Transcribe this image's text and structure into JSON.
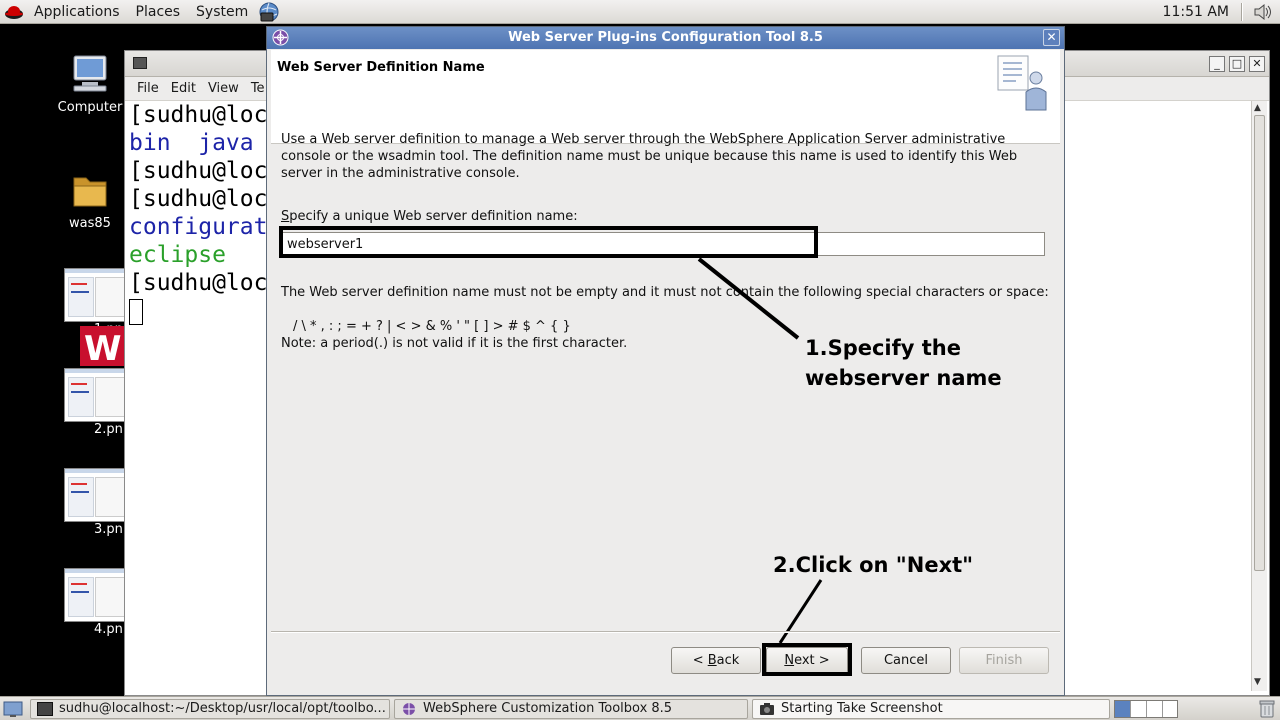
{
  "top_panel": {
    "menus": [
      "Applications",
      "Places",
      "System"
    ],
    "clock": "11:51 AM"
  },
  "desktop": {
    "icons": [
      {
        "label": "Computer"
      },
      {
        "label": "was85"
      }
    ],
    "thumbnails": [
      {
        "label": "1.pn"
      },
      {
        "label": "2.pn"
      },
      {
        "label": "3.pn"
      },
      {
        "label": "4.pn"
      }
    ]
  },
  "terminal": {
    "menus": [
      "File",
      "Edit",
      "View",
      "Te"
    ],
    "lines": [
      {
        "text": "[sudhu@loc",
        "color": "default"
      },
      {
        "text": "bin  java ",
        "color": "blue"
      },
      {
        "text": "[sudhu@loc",
        "color": "default"
      },
      {
        "text": "[sudhu@loc",
        "color": "default"
      },
      {
        "text": "configurat",
        "color": "blue"
      },
      {
        "text": "eclipse",
        "color": "green"
      },
      {
        "text": "[sudhu@loc",
        "color": "default"
      }
    ]
  },
  "dialog": {
    "title": "Web Server Plug-ins Configuration Tool 8.5",
    "header_title": "Web Server Definition Name",
    "description": "Use a Web server definition to manage a Web server through the WebSphere Application Server administrative console or the wsadmin tool. The definition name must be unique because this name is used to identify this Web server in the administrative console.",
    "field_label_underlined": "S",
    "field_label_rest": "pecify a unique Web server definition name:",
    "field_value": "webserver1",
    "rule_text": "The Web server definition name must not be empty and it must not contain the following special characters or space:",
    "special_chars": "/ \\ * , : ; = + ? | < > & % ' \" [ ] > # $ ^ { }",
    "note": "Note: a period(.) is not valid if it is the first character.",
    "annotations": {
      "step1_line1": "1.Specify the",
      "step1_line2": "webserver name",
      "step2": "2.Click on \"Next\""
    },
    "buttons": {
      "back_prefix": "< ",
      "back_underlined": "B",
      "back_rest": "ack",
      "next_underlined": "N",
      "next_rest": "ext >",
      "cancel": "Cancel",
      "finish": "Finish"
    }
  },
  "taskbar": {
    "tasks": [
      {
        "label": "sudhu@localhost:~/Desktop/usr/local/opt/toolbo..."
      },
      {
        "label": "WebSphere Customization Toolbox 8.5"
      },
      {
        "label": "Starting Take Screenshot"
      }
    ]
  }
}
